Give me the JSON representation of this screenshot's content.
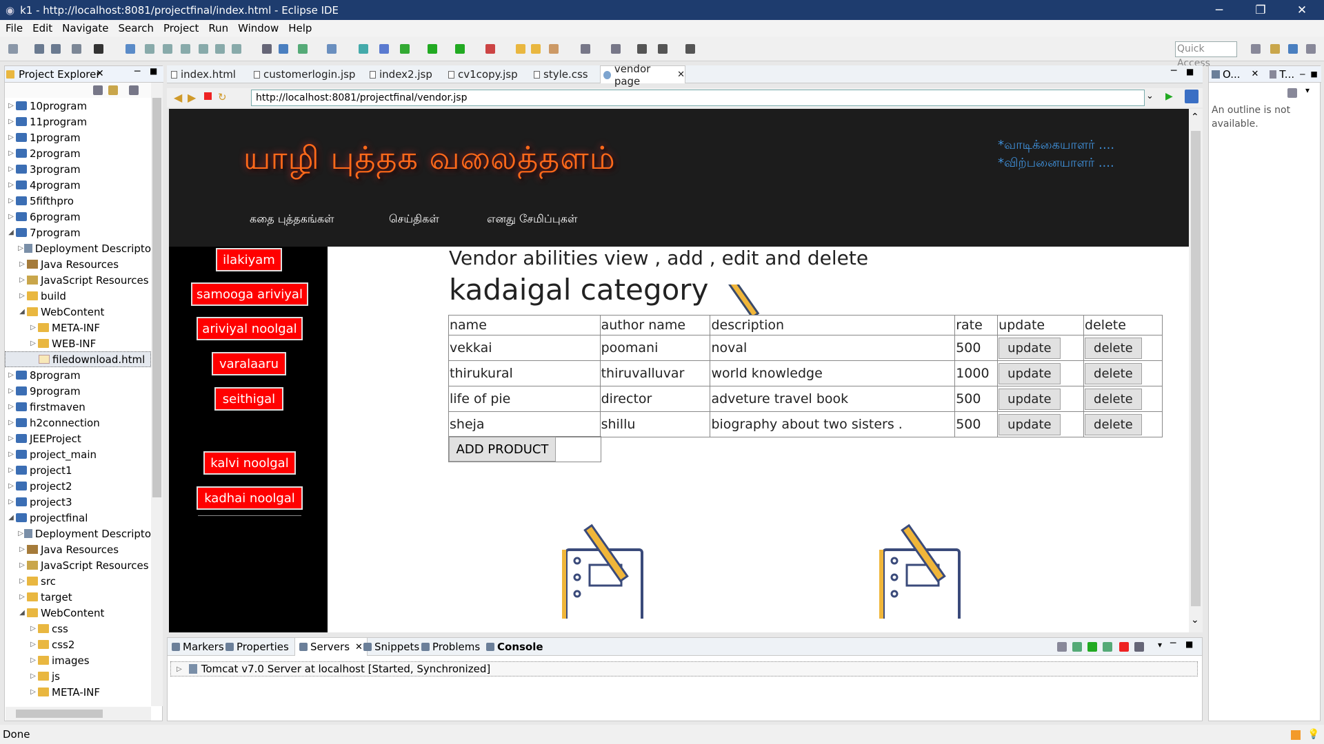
{
  "window": {
    "title": "k1 - http://localhost:8081/projectfinal/index.html - Eclipse IDE",
    "minimize": "─",
    "maximize": "❐",
    "close": "✕"
  },
  "menu": [
    "File",
    "Edit",
    "Navigate",
    "Search",
    "Project",
    "Run",
    "Window",
    "Help"
  ],
  "toolbar": {
    "quick_access": "Quick Access"
  },
  "project_explorer": {
    "title": "Project Explorer",
    "items": [
      {
        "label": "10program",
        "depth": 0,
        "icon": "project",
        "expanded": false
      },
      {
        "label": "11program",
        "depth": 0,
        "icon": "project",
        "expanded": false
      },
      {
        "label": "1program",
        "depth": 0,
        "icon": "project",
        "expanded": false
      },
      {
        "label": "2program",
        "depth": 0,
        "icon": "project",
        "expanded": false
      },
      {
        "label": "3program",
        "depth": 0,
        "icon": "project",
        "expanded": false
      },
      {
        "label": "4program",
        "depth": 0,
        "icon": "project",
        "expanded": false
      },
      {
        "label": "5fifthpro",
        "depth": 0,
        "icon": "project",
        "expanded": false
      },
      {
        "label": "6program",
        "depth": 0,
        "icon": "project",
        "expanded": false
      },
      {
        "label": "7program",
        "depth": 0,
        "icon": "project",
        "expanded": true
      },
      {
        "label": "Deployment Descripto",
        "depth": 1,
        "icon": "descriptor",
        "expanded": false
      },
      {
        "label": "Java Resources",
        "depth": 1,
        "icon": "jar",
        "expanded": false
      },
      {
        "label": "JavaScript Resources",
        "depth": 1,
        "icon": "js",
        "expanded": false
      },
      {
        "label": "build",
        "depth": 1,
        "icon": "folder",
        "expanded": false
      },
      {
        "label": "WebContent",
        "depth": 1,
        "icon": "folder",
        "expanded": true
      },
      {
        "label": "META-INF",
        "depth": 2,
        "icon": "folder",
        "expanded": false
      },
      {
        "label": "WEB-INF",
        "depth": 2,
        "icon": "folder",
        "expanded": false
      },
      {
        "label": "filedownload.html",
        "depth": 2,
        "icon": "file",
        "expanded": null,
        "selected": true
      },
      {
        "label": "8program",
        "depth": 0,
        "icon": "project",
        "expanded": false
      },
      {
        "label": "9program",
        "depth": 0,
        "icon": "project",
        "expanded": false
      },
      {
        "label": "firstmaven",
        "depth": 0,
        "icon": "project",
        "expanded": false
      },
      {
        "label": "h2connection",
        "depth": 0,
        "icon": "project",
        "expanded": false
      },
      {
        "label": "JEEProject",
        "depth": 0,
        "icon": "project",
        "expanded": false
      },
      {
        "label": "project_main",
        "depth": 0,
        "icon": "project",
        "expanded": false
      },
      {
        "label": "project1",
        "depth": 0,
        "icon": "project",
        "expanded": false
      },
      {
        "label": "project2",
        "depth": 0,
        "icon": "project",
        "expanded": false
      },
      {
        "label": "project3",
        "depth": 0,
        "icon": "project",
        "expanded": false
      },
      {
        "label": "projectfinal",
        "depth": 0,
        "icon": "project",
        "expanded": true
      },
      {
        "label": "Deployment Descripto",
        "depth": 1,
        "icon": "descriptor",
        "expanded": false
      },
      {
        "label": "Java Resources",
        "depth": 1,
        "icon": "jar",
        "expanded": false
      },
      {
        "label": "JavaScript Resources",
        "depth": 1,
        "icon": "js",
        "expanded": false
      },
      {
        "label": "src",
        "depth": 1,
        "icon": "folder",
        "expanded": false
      },
      {
        "label": "target",
        "depth": 1,
        "icon": "folder",
        "expanded": false
      },
      {
        "label": "WebContent",
        "depth": 1,
        "icon": "folder",
        "expanded": true
      },
      {
        "label": "css",
        "depth": 2,
        "icon": "folder",
        "expanded": false
      },
      {
        "label": "css2",
        "depth": 2,
        "icon": "folder",
        "expanded": false
      },
      {
        "label": "images",
        "depth": 2,
        "icon": "folder",
        "expanded": false
      },
      {
        "label": "js",
        "depth": 2,
        "icon": "folder",
        "expanded": false
      },
      {
        "label": "META-INF",
        "depth": 2,
        "icon": "folder",
        "expanded": false
      }
    ]
  },
  "editor_tabs": [
    {
      "label": "index.html",
      "active": false
    },
    {
      "label": "customerlogin.jsp",
      "active": false
    },
    {
      "label": "index2.jsp",
      "active": false
    },
    {
      "label": "cv1copy.jsp",
      "active": false
    },
    {
      "label": "style.css",
      "active": false
    },
    {
      "label": "vendor page",
      "active": true
    }
  ],
  "browser": {
    "url": "http://localhost:8081/projectfinal/vendor.jsp"
  },
  "site": {
    "logo": "யாழி புத்தக வலைத்தளம்",
    "roles": [
      "*வாடிக்கையாளர் ....",
      "*விற்பனையாளர் ...."
    ],
    "menu": [
      "கதை புத்தகங்கள்",
      "செய்திகள்",
      "எனது சேமிப்புகள்"
    ],
    "sidebar": [
      "ilakiyam",
      "samooga ariviyal",
      "ariviyal noolgal",
      "varalaaru",
      "seithigal",
      "kalvi noolgal",
      "kadhai noolgal"
    ],
    "heading": "Vendor abilities view , add , edit and delete",
    "category": "kadaigal category",
    "table": {
      "headers": [
        "name",
        "author name",
        "description",
        "rate",
        "update",
        "delete"
      ],
      "rows": [
        [
          "vekkai",
          "poomani",
          "noval",
          "500"
        ],
        [
          "thirukural",
          "thiruvalluvar",
          "world knowledge",
          "1000"
        ],
        [
          "life of pie",
          "director",
          "adveture travel book",
          "500"
        ],
        [
          "sheja",
          "shillu",
          "biography about two sisters .",
          "500"
        ]
      ],
      "update_label": "update",
      "delete_label": "delete"
    },
    "add_button": "ADD PRODUCT"
  },
  "outline": {
    "title": "O...",
    "title2": "T...",
    "message": "An outline is not available."
  },
  "bottom_tabs": [
    "Markers",
    "Properties",
    "Servers",
    "Snippets",
    "Problems",
    "Console"
  ],
  "server": "Tomcat v7.0 Server at localhost  [Started, Synchronized]",
  "status": "Done",
  "colors": {
    "accent": "#1e3c6e",
    "sidebar_btn": "#ff0000",
    "logo": "#ff6a1a",
    "role": "#3f8fd8"
  }
}
